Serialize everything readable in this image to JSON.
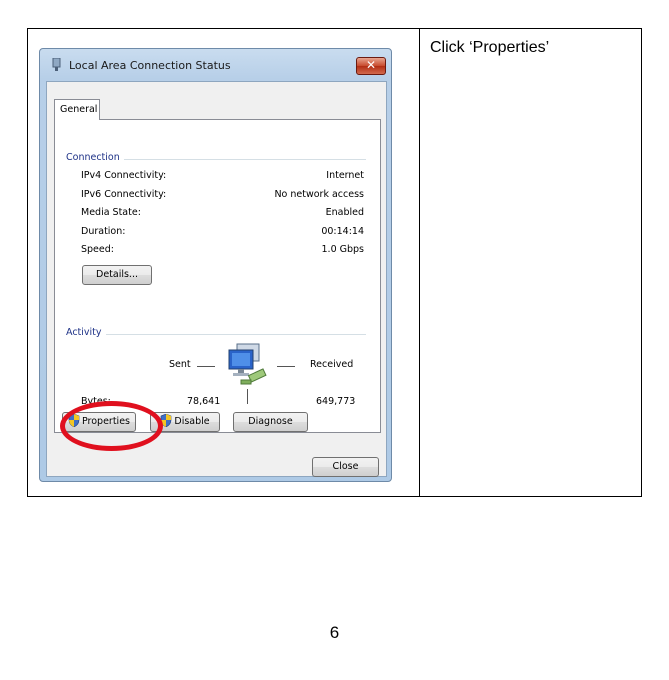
{
  "instruction": "Click ‘Properties’",
  "page_number": "6",
  "dialog": {
    "title": "Local Area Connection Status",
    "close_glyph": "✕",
    "tab": "General",
    "connection": {
      "heading": "Connection",
      "rows": [
        {
          "label": "IPv4 Connectivity:",
          "value": "Internet"
        },
        {
          "label": "IPv6 Connectivity:",
          "value": "No network access"
        },
        {
          "label": "Media State:",
          "value": "Enabled"
        },
        {
          "label": "Duration:",
          "value": "00:14:14"
        },
        {
          "label": "Speed:",
          "value": "1.0 Gbps"
        }
      ],
      "details_button": "Details..."
    },
    "activity": {
      "heading": "Activity",
      "sent_label": "Sent",
      "received_label": "Received",
      "bytes_label": "Bytes:",
      "bytes_sent": "78,641",
      "bytes_received": "649,773"
    },
    "buttons": {
      "properties": "Properties",
      "disable": "Disable",
      "diagnose": "Diagnose",
      "close": "Close"
    }
  },
  "colors": {
    "highlight": "#e0101e",
    "group_heading": "#1e3287"
  },
  "icons": [
    "network-adapter-icon",
    "shield-icon",
    "network-computers-icon",
    "close-icon"
  ]
}
